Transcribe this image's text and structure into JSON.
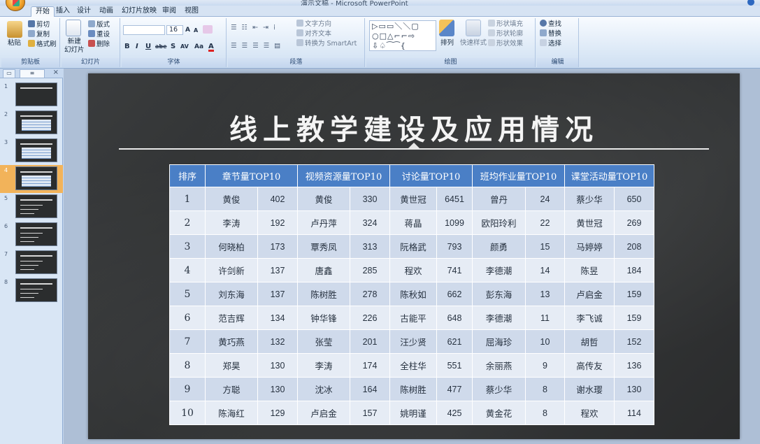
{
  "window": {
    "title": "演示文稿 - Microsoft PowerPoint"
  },
  "tabs": [
    "开始",
    "插入",
    "设计",
    "动画",
    "幻灯片放映",
    "审阅",
    "视图"
  ],
  "ribbon": {
    "clipboard": {
      "paste": "粘贴",
      "cut": "剪切",
      "copy": "复制",
      "format_painter": "格式刷",
      "label": "剪贴板"
    },
    "slides": {
      "new_slide": "新建\n幻灯片",
      "layout": "版式",
      "reset": "重设",
      "delete": "删除",
      "label": "幻灯片"
    },
    "font": {
      "size": "16",
      "grow": "A",
      "shrink": "A",
      "bold": "B",
      "italic": "I",
      "underline": "U",
      "strike": "abe",
      "shadow": "S",
      "spacing": "AV",
      "case": "Aa",
      "color": "A",
      "label": "字体"
    },
    "paragraph": {
      "text_direction": "文字方向",
      "align_text": "对齐文本",
      "smartart": "转换为 SmartArt",
      "label": "段落"
    },
    "drawing": {
      "shapes_preview": "▷▭▭＼＼▢\n○□△⌐⌐⇨\n⇩♤⁀⁀{",
      "arrange": "排列",
      "quick_styles": "快速样式",
      "fill": "形状填充",
      "outline": "形状轮廓",
      "effects": "形状效果",
      "label": "绘图"
    },
    "editing": {
      "find": "查找",
      "replace": "替换",
      "select": "选择",
      "label": "编辑"
    }
  },
  "panel": {
    "close": "×",
    "slides_tab": "▭",
    "outline_tab": "≡"
  },
  "thumbnails": [
    {
      "num": "1"
    },
    {
      "num": "2"
    },
    {
      "num": "3"
    },
    {
      "num": "4",
      "selected": true
    },
    {
      "num": "5"
    },
    {
      "num": "6"
    },
    {
      "num": "7"
    },
    {
      "num": "8"
    }
  ],
  "slide": {
    "title": "线上教学建设及应用情况",
    "table": {
      "headers": [
        "排序",
        "章节量TOP10",
        "视频资源量TOP10",
        "讨论量TOP10",
        "班均作业量TOP10",
        "课堂活动量TOP10"
      ],
      "rows": [
        [
          "1",
          "黄俊",
          "402",
          "黄俊",
          "330",
          "黄世冠",
          "6451",
          "曾丹",
          "24",
          "蔡少华",
          "650"
        ],
        [
          "2",
          "李涛",
          "192",
          "卢丹萍",
          "324",
          "蒋晶",
          "1099",
          "欧阳玲利",
          "22",
          "黄世冠",
          "269"
        ],
        [
          "3",
          "何晓柏",
          "173",
          "覃秀凤",
          "313",
          "阮格武",
          "793",
          "颜勇",
          "15",
          "马婷婷",
          "208"
        ],
        [
          "4",
          "许剑新",
          "137",
          "唐鑫",
          "285",
          "程欢",
          "741",
          "李德潮",
          "14",
          "陈昱",
          "184"
        ],
        [
          "5",
          "刘东海",
          "137",
          "陈树胜",
          "278",
          "陈秋如",
          "662",
          "彭东海",
          "13",
          "卢启金",
          "159"
        ],
        [
          "6",
          "范吉辉",
          "134",
          "钟华锋",
          "226",
          "古能平",
          "648",
          "李德潮",
          "11",
          "李飞诚",
          "159"
        ],
        [
          "7",
          "黄巧燕",
          "132",
          "张莹",
          "201",
          "汪少贤",
          "621",
          "屈海珍",
          "10",
          "胡哲",
          "152"
        ],
        [
          "8",
          "郑昊",
          "130",
          "李涛",
          "174",
          "全柱华",
          "551",
          "余丽燕",
          "9",
          "高传友",
          "136"
        ],
        [
          "9",
          "方聪",
          "130",
          "沈冰",
          "164",
          "陈树胜",
          "477",
          "蔡少华",
          "8",
          "谢水璎",
          "130"
        ],
        [
          "10",
          "陈海红",
          "129",
          "卢启金",
          "157",
          "姚明谨",
          "425",
          "黄金花",
          "8",
          "程欢",
          "114"
        ]
      ]
    }
  }
}
